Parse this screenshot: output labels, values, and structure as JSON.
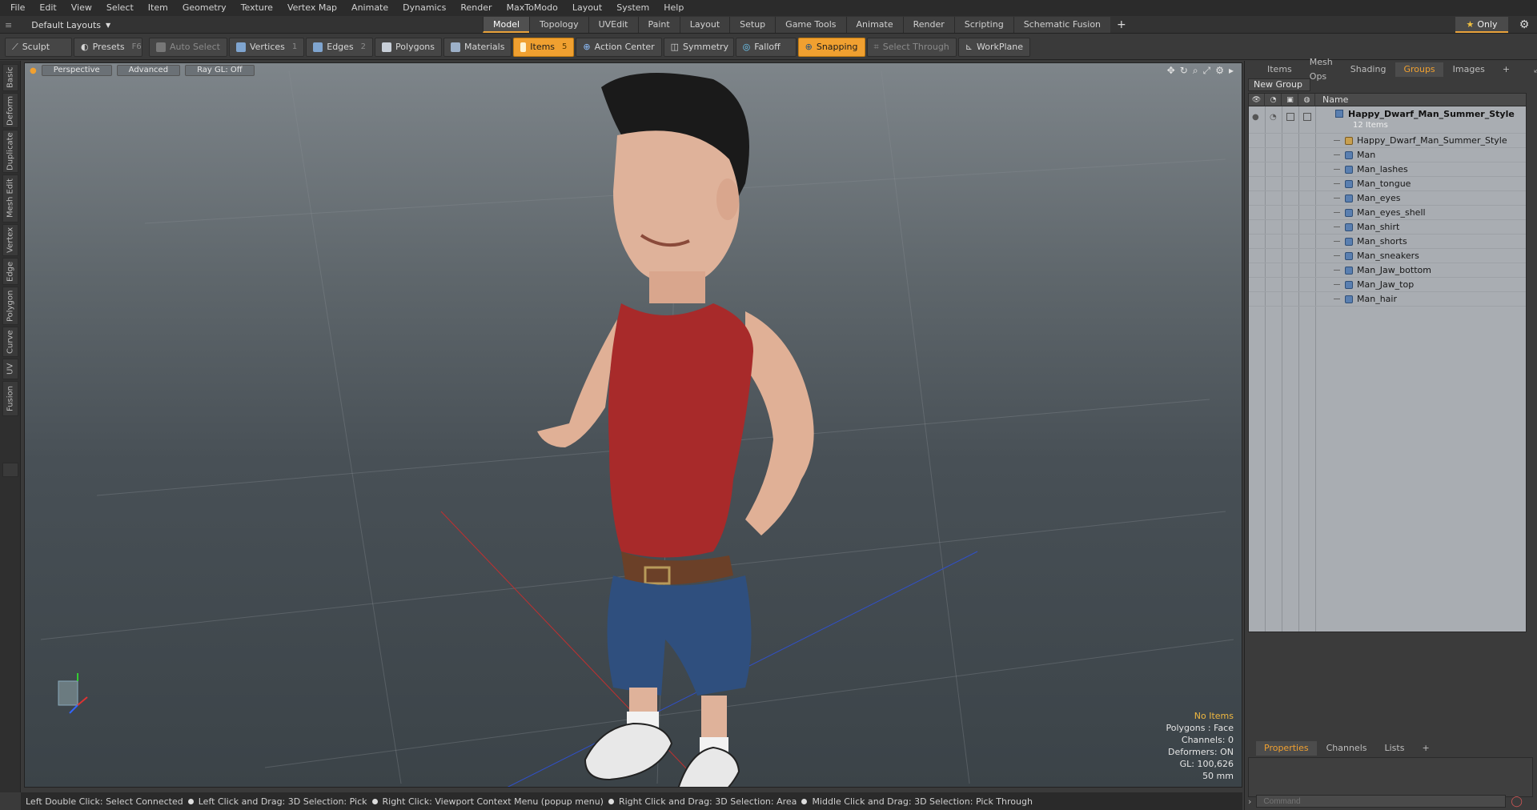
{
  "menu": [
    "File",
    "Edit",
    "View",
    "Select",
    "Item",
    "Geometry",
    "Texture",
    "Vertex Map",
    "Animate",
    "Dynamics",
    "Render",
    "MaxToModo",
    "Layout",
    "System",
    "Help"
  ],
  "layout_dropdown": "Default Layouts",
  "tabs": [
    "Model",
    "Topology",
    "UVEdit",
    "Paint",
    "Layout",
    "Setup",
    "Game Tools",
    "Animate",
    "Render",
    "Scripting",
    "Schematic Fusion"
  ],
  "active_tab": "Model",
  "only_label": "Only",
  "toolbar": {
    "sculpt": "Sculpt",
    "presets": "Presets",
    "presets_key": "F6",
    "auto_select": "Auto Select",
    "vertices": "Vertices",
    "vertices_key": "1",
    "edges": "Edges",
    "edges_key": "2",
    "polygons": "Polygons",
    "materials": "Materials",
    "items": "Items",
    "items_key": "5",
    "action_center": "Action Center",
    "symmetry": "Symmetry",
    "falloff": "Falloff",
    "snapping": "Snapping",
    "select_through": "Select Through",
    "workplane": "WorkPlane"
  },
  "left_tabs": [
    "Basic",
    "Deform",
    "Duplicate",
    "Mesh Edit",
    "Vertex",
    "Edge",
    "Polygon",
    "Curve",
    "UV",
    "Fusion"
  ],
  "viewport": {
    "perspective": "Perspective",
    "advanced": "Advanced",
    "raygl": "Ray GL: Off",
    "info": {
      "no_items": "No Items",
      "polygons": "Polygons : Face",
      "channels": "Channels: 0",
      "deformers": "Deformers: ON",
      "gl": "GL: 100,626",
      "mm": "50 mm"
    }
  },
  "status": [
    "Left Double Click: Select Connected",
    "Left Click and Drag: 3D Selection: Pick",
    "Right Click: Viewport Context Menu (popup menu)",
    "Right Click and Drag: 3D Selection: Area",
    "Middle Click and Drag: 3D Selection: Pick Through"
  ],
  "right_tabs": [
    "Items",
    "Mesh Ops",
    "Shading",
    "Groups",
    "Images"
  ],
  "active_right_tab": "Groups",
  "new_group": "New Group",
  "list_header": "Name",
  "group": {
    "name": "Happy_Dwarf_Man_Summer_Style",
    "count": "12 Items"
  },
  "items": [
    "Happy_Dwarf_Man_Summer_Style",
    "Man",
    "Man_lashes",
    "Man_tongue",
    "Man_eyes",
    "Man_eyes_shell",
    "Man_shirt",
    "Man_shorts",
    "Man_sneakers",
    "Man_Jaw_bottom",
    "Man_Jaw_top",
    "Man_hair"
  ],
  "prop_tabs": [
    "Properties",
    "Channels",
    "Lists"
  ],
  "active_prop_tab": "Properties",
  "command_placeholder": "Command",
  "colors": {
    "accent": "#f0a030",
    "shirt": "#a82a2a",
    "shorts": "#2f4f7e",
    "skin": "#e2b49a"
  }
}
